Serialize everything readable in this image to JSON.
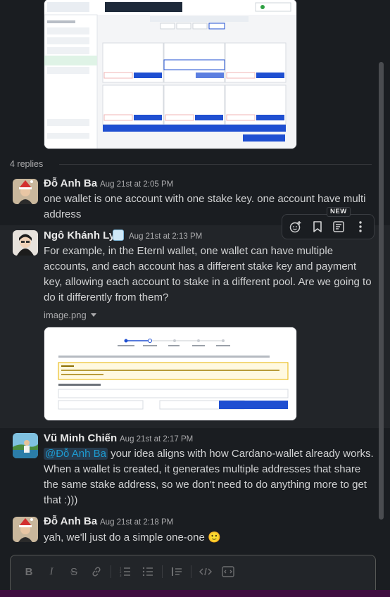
{
  "thread": {
    "reply_count_label": "4 replies"
  },
  "messages": [
    {
      "author": "Đỗ Anh Ba",
      "time": "Aug 21st at 2:05 PM",
      "text": "one wallet is one account with one stake key. one account have multi address"
    },
    {
      "author": "Ngô Khánh Ly",
      "time": "Aug 21st at 2:13 PM",
      "text": "For example, in the Eternl wallet, one wallet can have multiple accounts, and each account has a different stake key and payment key, allowing each account to stake in a different pool. Are we going to do it differently from them?",
      "attachment_name": "image.png"
    },
    {
      "author": "Vũ Minh Chiến",
      "time": "Aug 21st at 2:17 PM",
      "mention": "@Đỗ Anh Ba",
      "text": "your idea aligns with how Cardano-wallet already works. When a wallet is created, it generates multiple addresses that share the same stake address, so we don't need to do anything more to get that :)))"
    },
    {
      "author": "Đỗ Anh Ba",
      "time": "Aug 21st at 2:18 PM",
      "text": "yah, we'll  just do  a simple one-one",
      "emoji": "🙂"
    }
  ],
  "toolbar": {
    "new_badge": "NEW",
    "icons": [
      "add-reaction-icon",
      "bookmark-icon",
      "reply-thread-icon",
      "more-actions-icon"
    ]
  },
  "composer": {
    "icons": [
      "bold-icon",
      "italic-icon",
      "strikethrough-icon",
      "link-icon",
      "ordered-list-icon",
      "bulleted-list-icon",
      "blockquote-icon",
      "code-icon",
      "code-block-icon"
    ]
  },
  "colors": {
    "background": "#1a1d21",
    "hover_background": "#222529",
    "mention_text": "#1d9bd1",
    "mention_bg": "#263a4d"
  }
}
